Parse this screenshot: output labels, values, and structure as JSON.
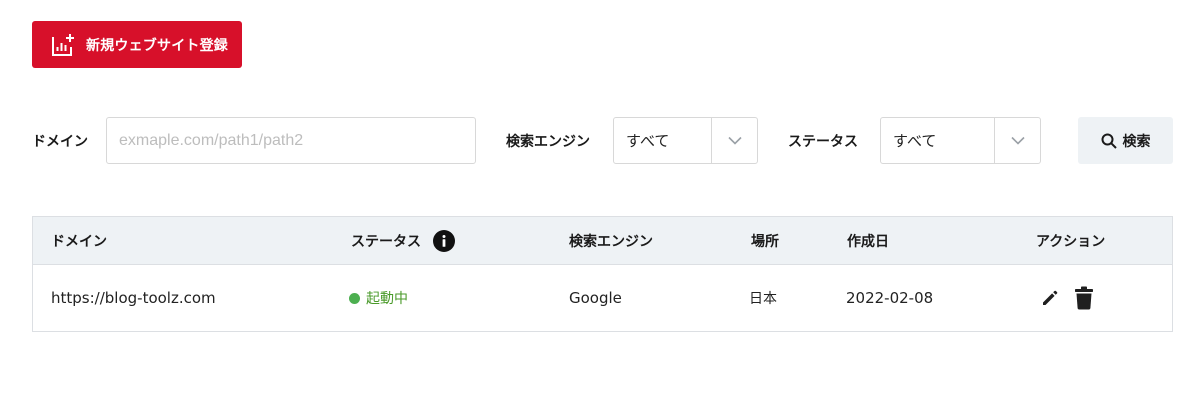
{
  "toolbar": {
    "register_label": "新規ウェブサイト登録",
    "register_icon": "chart-add-icon",
    "brand_color": "#d7102a"
  },
  "filters": {
    "domain_label": "ドメイン",
    "domain_placeholder": "exmaple.com/path1/path2",
    "domain_value": "",
    "engine_label": "検索エンジン",
    "engine_value": "すべて",
    "status_label": "ステータス",
    "status_value": "すべて",
    "search_label": "検索",
    "search_icon": "search-icon"
  },
  "table": {
    "headers": [
      "ドメイン",
      "ステータス",
      "検索エンジン",
      "場所",
      "作成日",
      "アクション"
    ],
    "rows": [
      {
        "domain": "https://blog-toolz.com",
        "status": "起動中",
        "status_color": "#4caf50",
        "engine": "Google",
        "location": "日本",
        "created": "2022-02-08"
      }
    ]
  }
}
